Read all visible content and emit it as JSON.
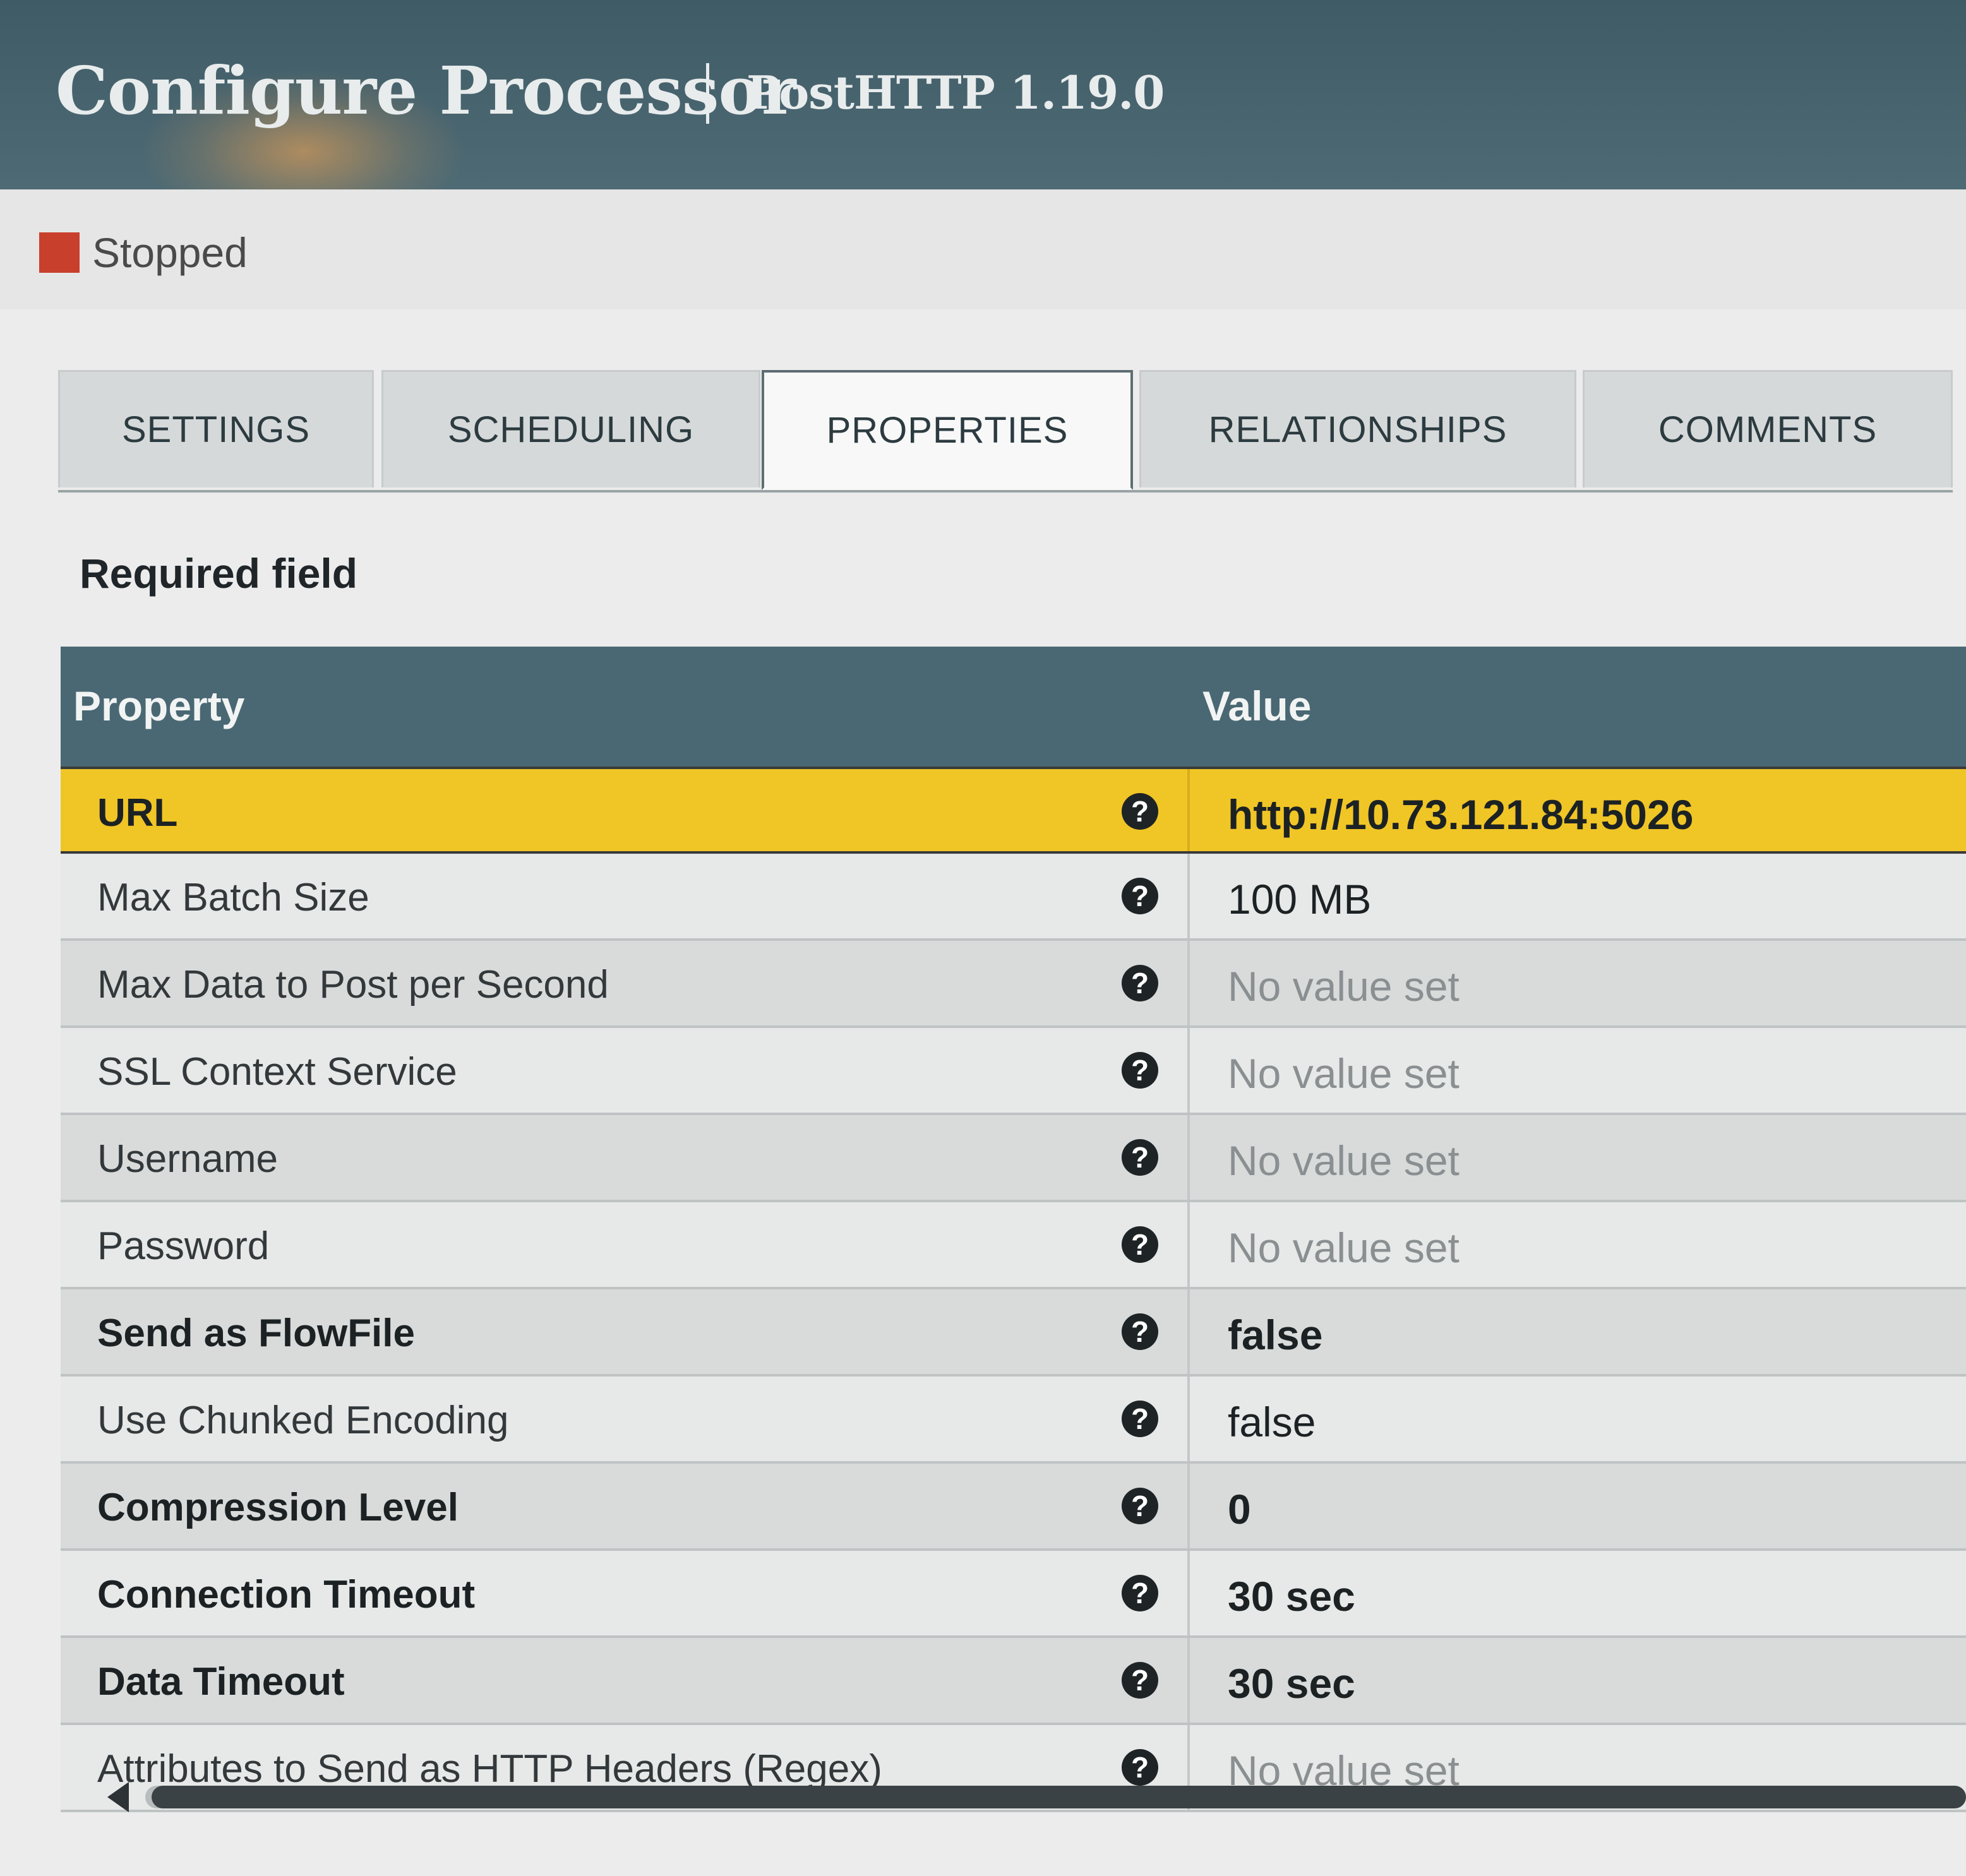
{
  "header": {
    "title": "Configure Processor",
    "subtitle": "PostHTTP 1.19.0"
  },
  "status": {
    "text": "Stopped",
    "color": "#c8402c"
  },
  "tabs": [
    {
      "label": "SETTINGS",
      "active": false
    },
    {
      "label": "SCHEDULING",
      "active": false
    },
    {
      "label": "PROPERTIES",
      "active": true
    },
    {
      "label": "RELATIONSHIPS",
      "active": false
    },
    {
      "label": "COMMENTS",
      "active": false
    }
  ],
  "required_label": "Required field",
  "table": {
    "headers": {
      "property": "Property",
      "value": "Value"
    },
    "rows": [
      {
        "name": "URL",
        "value": "http://10.73.121.84:5026",
        "required": true,
        "set": true,
        "selected": true
      },
      {
        "name": "Max Batch Size",
        "value": "100 MB",
        "required": false,
        "set": true
      },
      {
        "name": "Max Data to Post per Second",
        "value": "No value set",
        "required": false,
        "set": false
      },
      {
        "name": "SSL Context Service",
        "value": "No value set",
        "required": false,
        "set": false
      },
      {
        "name": "Username",
        "value": "No value set",
        "required": false,
        "set": false
      },
      {
        "name": "Password",
        "value": "No value set",
        "required": false,
        "set": false
      },
      {
        "name": "Send as FlowFile",
        "value": "false",
        "required": true,
        "set": true
      },
      {
        "name": "Use Chunked Encoding",
        "value": "false",
        "required": false,
        "set": true
      },
      {
        "name": "Compression Level",
        "value": "0",
        "required": true,
        "set": true
      },
      {
        "name": "Connection Timeout",
        "value": "30 sec",
        "required": true,
        "set": true
      },
      {
        "name": "Data Timeout",
        "value": "30 sec",
        "required": true,
        "set": true
      },
      {
        "name": "Attributes to Send as HTTP Headers (Regex)",
        "value": "No value set",
        "required": false,
        "set": false
      }
    ],
    "help_icon": "question-circle-icon"
  },
  "colors": {
    "header_bg": "#48646f",
    "table_header_bg": "#4a6873",
    "selected_row": "#f0c526",
    "stopped_icon": "#c8402c"
  }
}
